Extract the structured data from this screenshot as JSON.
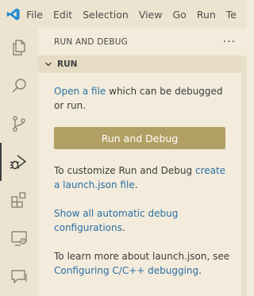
{
  "menubar": {
    "items": [
      "File",
      "Edit",
      "Selection",
      "View",
      "Go",
      "Run",
      "Te"
    ],
    "logo_icon": "vscode-logo-icon",
    "logo_color": "#1f8ad2"
  },
  "activity_bar": {
    "items": [
      {
        "icon": "files-icon"
      },
      {
        "icon": "search-icon"
      },
      {
        "icon": "source-control-icon"
      },
      {
        "icon": "run-debug-icon",
        "active": true
      },
      {
        "icon": "extensions-icon"
      },
      {
        "icon": "remote-explorer-icon"
      },
      {
        "icon": "comments-icon"
      }
    ]
  },
  "sidebar": {
    "title": "RUN AND DEBUG",
    "more_label": "···",
    "section": {
      "label": "RUN",
      "expanded": true
    },
    "open_file_link": "Open a file",
    "open_file_rest": " which can be debugged or run.",
    "run_button_label": "Run and Debug",
    "customize_text": "To customize Run and Debug ",
    "customize_link": "create a launch.json file",
    "customize_end": ".",
    "show_all_link": "Show all automatic debug configurations",
    "show_all_end": ".",
    "learn_text": "To learn more about launch.json, see ",
    "learn_link": "Configuring C/C++ debugging",
    "learn_end": "."
  },
  "colors": {
    "background": "#f3ecdc",
    "button": "#b29f63",
    "link": "#2b6fa5"
  }
}
